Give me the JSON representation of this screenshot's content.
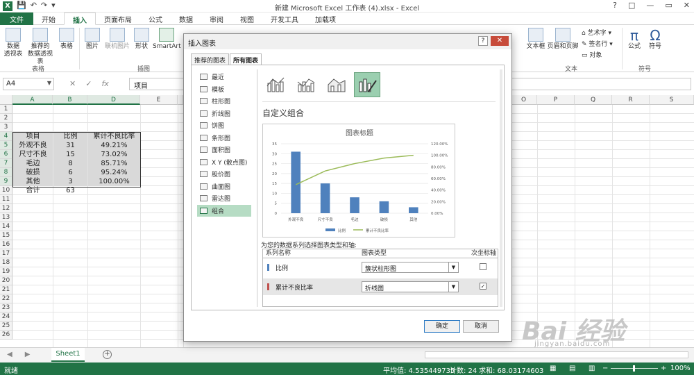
{
  "window": {
    "title": "新建 Microsoft Excel 工作表 (4).xlsx - Excel",
    "logo": "X",
    "controls": [
      "?",
      "□",
      "—",
      "▭",
      "✕"
    ]
  },
  "ribbon_tabs": [
    "文件",
    "开始",
    "插入",
    "页面布局",
    "公式",
    "数据",
    "审阅",
    "视图",
    "开发工具",
    "加载项"
  ],
  "active_tab": "插入",
  "ribbon": {
    "pivot": "数据\n透视表",
    "rec_pivot": "推荐的\n数据透视表",
    "table": "表格",
    "picture": "图片",
    "online_pic": "联机图片",
    "shapes": "形状",
    "smartart": "SmartArt",
    "textbox": "文本框",
    "header_footer": "页眉和页脚",
    "wordart": "艺术字",
    "signature": "签名行",
    "object": "对象",
    "formula": "公式",
    "symbol": "符号",
    "groups": {
      "tables": "表格",
      "illustrations": "插图",
      "text": "文本",
      "symbols": "符号"
    }
  },
  "formula_bar": {
    "name_box": "A4",
    "content": "项目",
    "fx": "fx"
  },
  "columns": [
    "A",
    "B",
    "D",
    "E",
    "O",
    "P",
    "Q",
    "R",
    "S"
  ],
  "rows": [
    "1",
    "2",
    "3",
    "4",
    "5",
    "6",
    "7",
    "8",
    "9",
    "10",
    "11",
    "12",
    "13",
    "14",
    "15",
    "16",
    "17",
    "18",
    "19",
    "20",
    "21",
    "22",
    "23",
    "24",
    "25",
    "26"
  ],
  "table": {
    "header": [
      "项目",
      "比例",
      "累计不良比率"
    ],
    "rows": [
      [
        "外观不良",
        "31",
        "49.21%"
      ],
      [
        "尺寸不良",
        "15",
        "73.02%"
      ],
      [
        "毛边",
        "8",
        "85.71%"
      ],
      [
        "破损",
        "6",
        "95.24%"
      ],
      [
        "其他",
        "3",
        "100.00%"
      ]
    ],
    "total": [
      "合计",
      "63",
      ""
    ]
  },
  "sheet": {
    "name": "Sheet1"
  },
  "status": {
    "ready": "就绪",
    "average": "平均值: 4.535449735",
    "count": "计数: 24",
    "sum": "求和: 68.03174603",
    "zoom": "100%"
  },
  "dialog": {
    "title": "插入图表",
    "tabs": [
      "推荐的图表",
      "所有图表"
    ],
    "active_tab": "所有图表",
    "chart_types": [
      "最近",
      "模板",
      "柱形图",
      "折线图",
      "饼图",
      "条形图",
      "面积图",
      "X Y (散点图)",
      "股价图",
      "曲面图",
      "雷达图",
      "组合"
    ],
    "selected_type": "组合",
    "combo_title": "自定义组合",
    "series_prompt": "为您的数据系列选择图表类型和轴:",
    "series_headers": [
      "系列名称",
      "图表类型",
      "次坐标轴"
    ],
    "series": [
      {
        "name": "比例",
        "chart_type": "簇状柱形图",
        "secondary": false,
        "color": "#4f81bd"
      },
      {
        "name": "累计不良比率",
        "chart_type": "折线图",
        "secondary": true,
        "color": "#c0504d"
      }
    ],
    "ok": "确定",
    "cancel": "取消"
  },
  "chart_data": {
    "type": "bar",
    "title": "图表标题",
    "categories": [
      "外观不良",
      "尺寸不良",
      "毛边",
      "破损",
      "其他"
    ],
    "series": [
      {
        "name": "比例",
        "type": "bar",
        "values": [
          31,
          15,
          8,
          6,
          3
        ],
        "color": "#4f81bd"
      },
      {
        "name": "累计不良比率",
        "type": "line",
        "values": [
          49.21,
          73.02,
          85.71,
          95.24,
          100.0
        ],
        "color": "#9bbb59",
        "axis": "secondary"
      }
    ],
    "ylim": [
      0,
      35
    ],
    "yticks": [
      "35",
      "30",
      "25",
      "20",
      "15",
      "10",
      "5",
      "0"
    ],
    "y2lim": [
      0,
      120
    ],
    "y2ticks": [
      "120.00%",
      "100.00%",
      "80.00%",
      "60.00%",
      "40.00%",
      "20.00%",
      "0.00%"
    ],
    "legend_position": "bottom"
  },
  "watermark": {
    "brand": "Bai 经验",
    "site": "jingyan.baidu.com"
  }
}
